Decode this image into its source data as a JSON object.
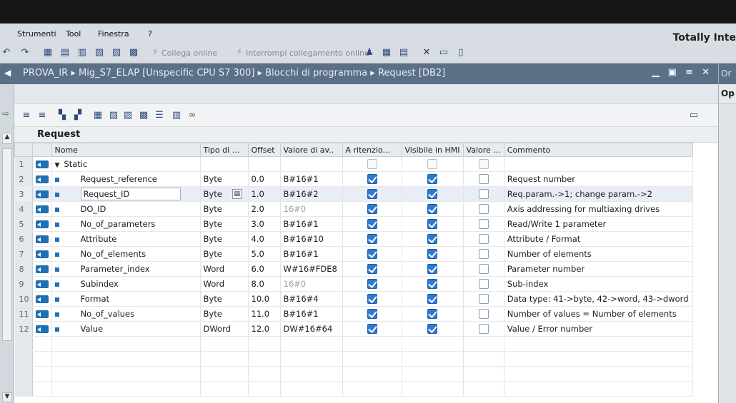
{
  "menu": [
    "Strumenti",
    "Tool",
    "Finestra",
    "?"
  ],
  "brand": "Totally Inte",
  "toolbar": {
    "go_online": "Collega online",
    "go_offline": "Interrompi collegamento online"
  },
  "breadcrumb": {
    "parts": [
      "PROVA_IR",
      "Mig_S7_ELAP [Unspecific CPU S7 300]",
      "Blocchi di programma",
      "Request [DB2]"
    ],
    "separator": "▸"
  },
  "right_panel": {
    "header": "Or",
    "options": "Op"
  },
  "block_title": "Request",
  "columns": [
    "Nome",
    "Tipo di ...",
    "Offset",
    "Valore di av..",
    "A ritenzio...",
    "Visibile in HMI",
    "Valore ...",
    "Commento"
  ],
  "rows": [
    {
      "num": "1",
      "name": "Static",
      "type": "",
      "offset": "",
      "start": "",
      "retain": "grey",
      "hmi": "grey",
      "setpoint": "grey",
      "comment": "",
      "static": true
    },
    {
      "num": "2",
      "name": "Request_reference",
      "type": "Byte",
      "offset": "0.0",
      "start": "B#16#1",
      "retain": "on",
      "hmi": "on",
      "setpoint": "off",
      "comment": "Request number"
    },
    {
      "num": "3",
      "name": "Request_ID",
      "type": "Byte",
      "offset": "1.0",
      "start": "B#16#2",
      "retain": "on",
      "hmi": "on",
      "setpoint": "off",
      "comment": "Req.param.->1; change param.->2",
      "selected": true
    },
    {
      "num": "4",
      "name": "DO_ID",
      "type": "Byte",
      "offset": "2.0",
      "start": "16#0",
      "start_muted": true,
      "retain": "on",
      "hmi": "on",
      "setpoint": "off",
      "comment": "Axis addressing for multiaxing drives"
    },
    {
      "num": "5",
      "name": "No_of_parameters",
      "type": "Byte",
      "offset": "3.0",
      "start": "B#16#1",
      "retain": "on",
      "hmi": "on",
      "setpoint": "off",
      "comment": "Read/Write 1 parameter"
    },
    {
      "num": "6",
      "name": "Attribute",
      "type": "Byte",
      "offset": "4.0",
      "start": "B#16#10",
      "retain": "on",
      "hmi": "on",
      "setpoint": "off",
      "comment": "Attribute / Format"
    },
    {
      "num": "7",
      "name": "No_of_elements",
      "type": "Byte",
      "offset": "5.0",
      "start": "B#16#1",
      "retain": "on",
      "hmi": "on",
      "setpoint": "off",
      "comment": "Number of elements"
    },
    {
      "num": "8",
      "name": "Parameter_index",
      "type": "Word",
      "offset": "6.0",
      "start": "W#16#FDE8",
      "retain": "on",
      "hmi": "on",
      "setpoint": "off",
      "comment": "Parameter number"
    },
    {
      "num": "9",
      "name": "Subindex",
      "type": "Word",
      "offset": "8.0",
      "start": "16#0",
      "start_muted": true,
      "retain": "on",
      "hmi": "on",
      "setpoint": "off",
      "comment": "Sub-index"
    },
    {
      "num": "10",
      "name": "Format",
      "type": "Byte",
      "offset": "10.0",
      "start": "B#16#4",
      "retain": "on",
      "hmi": "on",
      "setpoint": "off",
      "comment": "Data type: 41->byte, 42->word, 43->dword"
    },
    {
      "num": "11",
      "name": "No_of_values",
      "type": "Byte",
      "offset": "11.0",
      "start": "B#16#1",
      "retain": "on",
      "hmi": "on",
      "setpoint": "off",
      "comment": "Number of values = Number of elements"
    },
    {
      "num": "12",
      "name": "Value",
      "type": "DWord",
      "offset": "12.0",
      "start": "DW#16#64",
      "retain": "on",
      "hmi": "on",
      "setpoint": "off",
      "comment": "Value / Error number"
    }
  ]
}
